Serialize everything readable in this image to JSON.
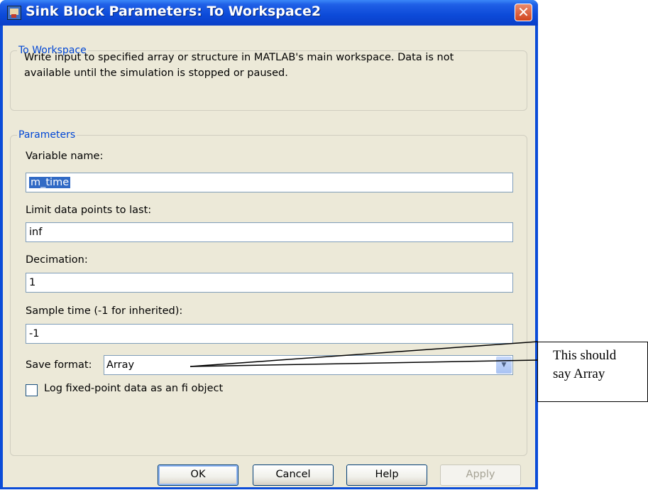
{
  "window": {
    "title": "Sink Block Parameters: To Workspace2",
    "close_glyph": "✕"
  },
  "group_to_workspace": {
    "legend": "To Workspace",
    "description_line1": "Write input to specified array or structure in MATLAB's main workspace. Data is not",
    "description_line2": "available until the simulation is stopped or paused."
  },
  "group_parameters": {
    "legend": "Parameters",
    "variable_name": {
      "label": "Variable name:",
      "value": "m_time"
    },
    "limit_points": {
      "label": "Limit data points to last:",
      "value": "inf"
    },
    "decimation": {
      "label": "Decimation:",
      "value": "1"
    },
    "sample_time": {
      "label": "Sample time (-1 for inherited):",
      "value": "-1"
    },
    "save_format": {
      "label": "Save format:",
      "value": "Array"
    },
    "log_fixed_point": {
      "label": "Log fixed-point data as an fi object",
      "checked": false
    }
  },
  "buttons": {
    "ok": "OK",
    "cancel": "Cancel",
    "help": "Help",
    "apply": "Apply"
  },
  "annotation": {
    "line1": "This should",
    "line2": "say Array"
  }
}
